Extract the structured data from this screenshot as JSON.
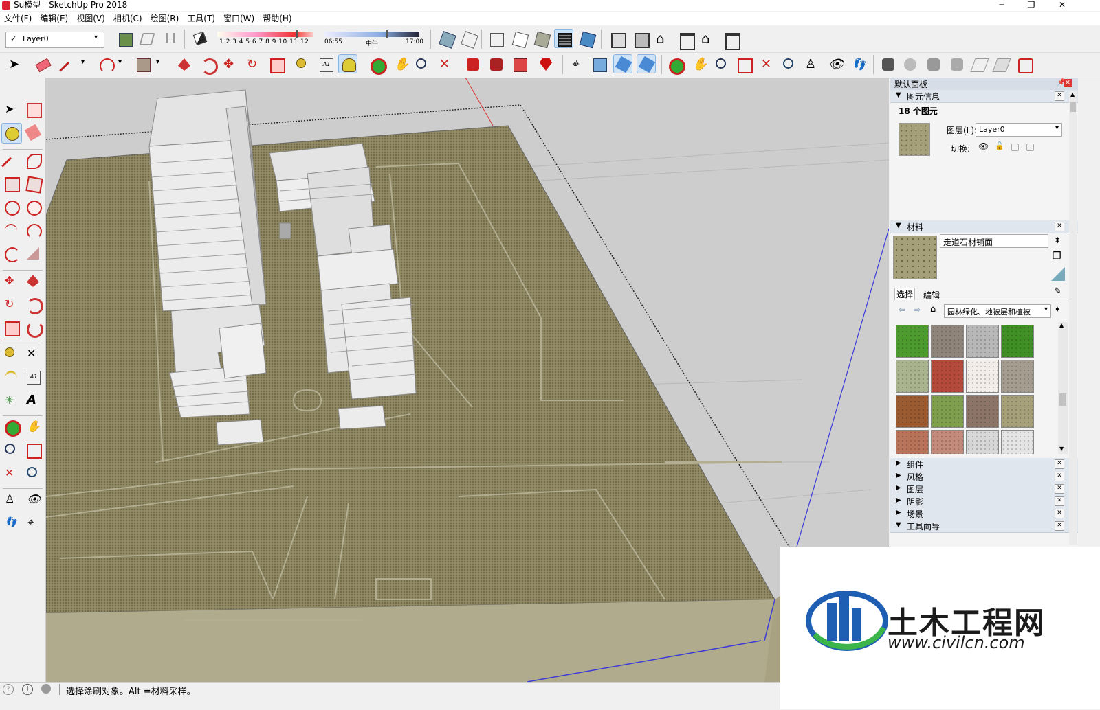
{
  "window": {
    "title": "Su模型 - SketchUp Pro 2018",
    "controls": [
      "─",
      "❐",
      "✕"
    ]
  },
  "menu": [
    "文件(F)",
    "编辑(E)",
    "视图(V)",
    "相机(C)",
    "绘图(R)",
    "工具(T)",
    "窗口(W)",
    "帮助(H)"
  ],
  "toolbar": {
    "layer_value": "Layer0",
    "shadow_months": "1 2 3 4 5 6 7 8 9 10 11 12",
    "time_start": "06:55",
    "time_mid": "中午",
    "time_end": "17:00"
  },
  "panel": {
    "title": "默认面板",
    "entity_info": {
      "header": "图元信息",
      "count": "18 个图元",
      "layer_label": "图层(L):",
      "layer_value": "Layer0",
      "toggle_label": "切换:"
    },
    "materials": {
      "header": "材料",
      "name": "走道石材铺面",
      "tab_select": "选择",
      "tab_edit": "编辑",
      "collection": "园林绿化、地被层和植被",
      "swatch_colors": [
        "#4d9a2f",
        "#8e8479",
        "#b7b7b7",
        "#3f8f25",
        "#a9b48f",
        "#b34a3a",
        "#f2ede8",
        "#a39c8f",
        "#9a5a32",
        "#7f9f4f",
        "#8c7566",
        "#a5a07a",
        "#b8735b",
        "#c28a7a",
        "#d7d7d7",
        "#e4e4e4"
      ]
    },
    "collapsed": [
      "组件",
      "风格",
      "图层",
      "阴影",
      "场景"
    ],
    "expanded_last": "工具向导"
  },
  "status": {
    "message": "选择涂刷对象。Alt =材料采样。"
  },
  "watermark": {
    "name": "土木工程网",
    "url": "www.civilcn.com"
  }
}
